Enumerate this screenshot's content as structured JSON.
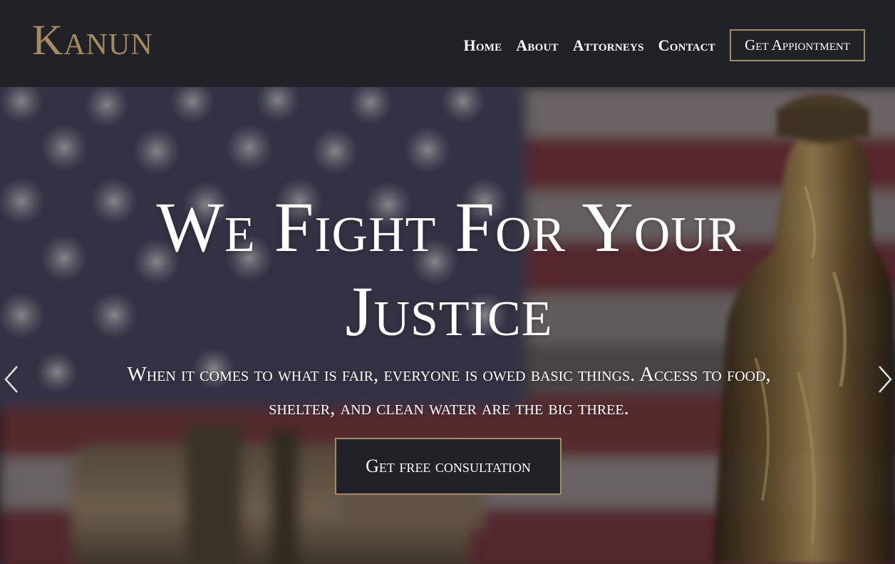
{
  "brand": {
    "name": "Kanun",
    "accent_color": "#a58c5f",
    "header_bg": "#202227"
  },
  "nav": {
    "items": [
      {
        "label": "Home"
      },
      {
        "label": "About"
      },
      {
        "label": "Attorneys"
      },
      {
        "label": "Contact"
      }
    ],
    "cta_label": "Get Appiontment"
  },
  "hero": {
    "headline": "We Fight For Your Justice",
    "subtext": "When it comes to what is fair, everyone is owed basic things. Access to food, shelter, and clean water are the big three.",
    "cta_label": "Get free consultation",
    "background": "american flag with gavel and lady justice statue",
    "prev_icon": "chevron-left-icon",
    "next_icon": "chevron-right-icon"
  }
}
